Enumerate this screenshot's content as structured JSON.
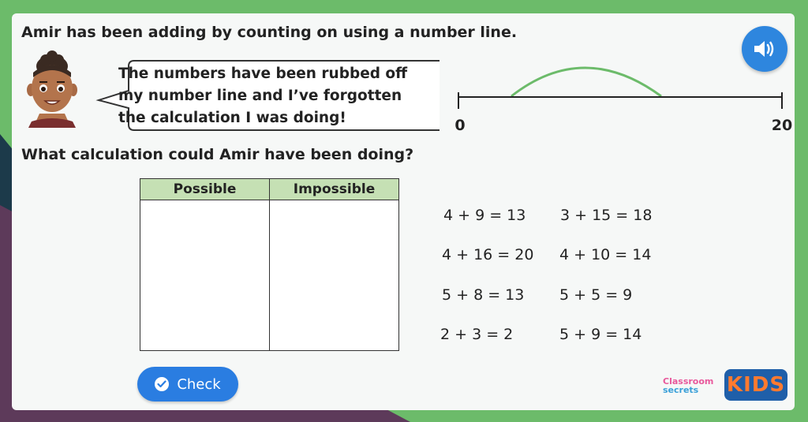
{
  "title": "Amir has been adding by counting on using a number line.",
  "speech": {
    "line1": "The numbers have been rubbed off",
    "line2": "my number line and I’ve forgotten",
    "line3": "the calculation I was doing!"
  },
  "number_line": {
    "start_label": "0",
    "end_label": "20"
  },
  "question": "What calculation could Amir have been doing?",
  "table": {
    "col1": "Possible",
    "col2": "Impossible"
  },
  "equations": [
    "4 + 9 = 13",
    "3 + 15 = 18",
    "4 + 16 = 20",
    "4 + 10 = 14",
    "5 + 8 = 13",
    "5 + 5 = 9",
    "2 + 3 = 2",
    "5 + 9 = 14"
  ],
  "check_label": "Check",
  "logo": {
    "brand_top": "Classroom",
    "brand_bottom": "secrets",
    "kids": "KIDS"
  },
  "colors": {
    "accent": "#2a7de1",
    "arc": "#6cbb6a",
    "table_header": "#c5e0b4"
  },
  "icons": {
    "audio": "speaker-icon",
    "check": "checkmark-icon"
  }
}
